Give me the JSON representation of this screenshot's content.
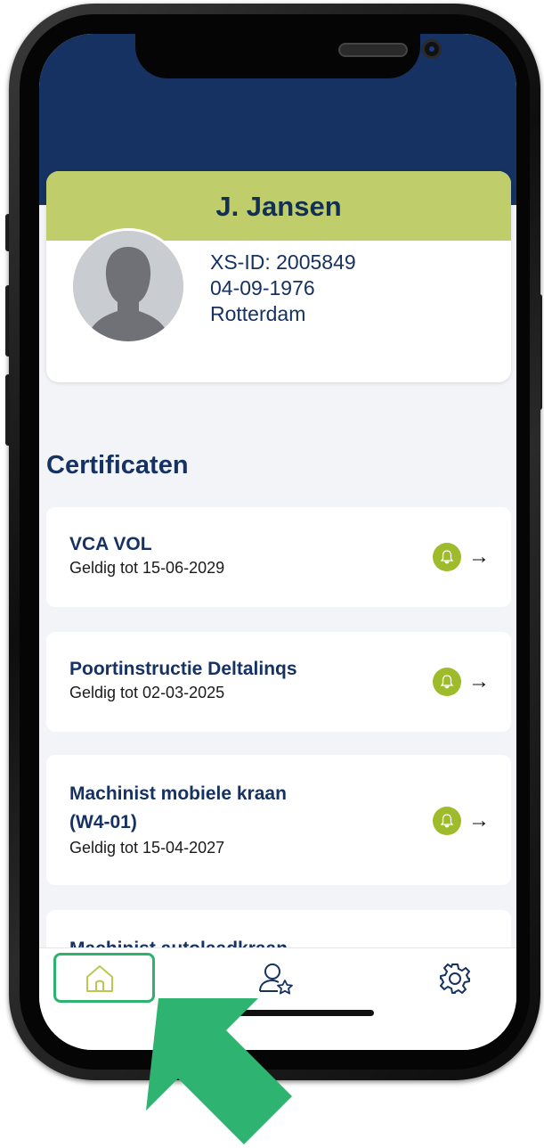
{
  "profile": {
    "name": "J. Jansen",
    "xs_id": "XS-ID: 2005849",
    "birthdate": "04-09-1976",
    "city": "Rotterdam"
  },
  "section_title": "Certificaten",
  "certificates": [
    {
      "title_line1": "VCA VOL",
      "title_line2": "",
      "valid": "Geldig tot 15-06-2029"
    },
    {
      "title_line1": "Poortinstructie Deltalinqs",
      "title_line2": "",
      "valid": "Geldig tot 02-03-2025"
    },
    {
      "title_line1": "Machinist mobiele kraan",
      "title_line2": "(W4-01)",
      "valid": "Geldig tot 15-04-2027"
    },
    {
      "title_line1": "Machinist autolaadkraan",
      "title_line2": "",
      "valid": ""
    }
  ],
  "icons": {
    "arrow": "→",
    "bell": "bell-icon",
    "home": "home-icon",
    "profile": "user-star-icon",
    "settings": "gear-icon"
  },
  "colors": {
    "header_bg": "#163262",
    "name_band": "#bfce6a",
    "bell_bg": "#9dbb2a",
    "highlight": "#2eb36f"
  }
}
